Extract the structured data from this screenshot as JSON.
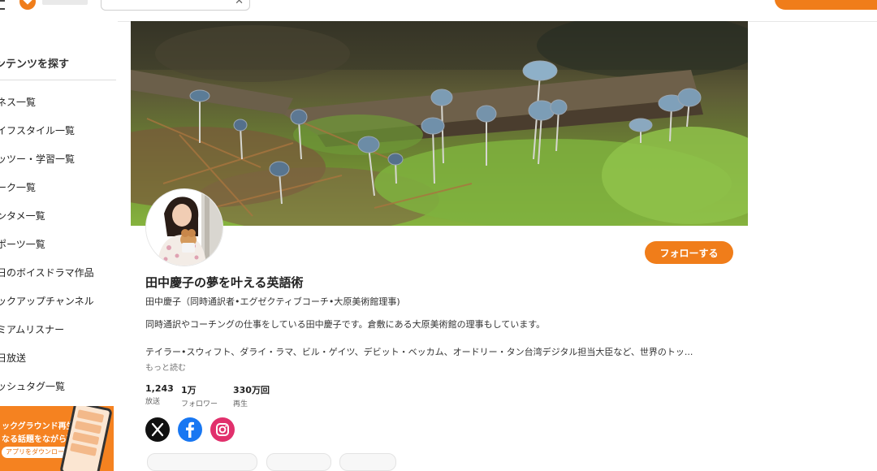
{
  "sidebar": {
    "title": "ンテンツを探す",
    "items": [
      {
        "label": "ネス一覧"
      },
      {
        "label": "イフスタイル一覧"
      },
      {
        "label": "ッツー・学習一覧"
      },
      {
        "label": "ーク一覧"
      },
      {
        "label": "ンタメ一覧"
      },
      {
        "label": "ポーツ一覧"
      },
      {
        "label": "日のボイスドラマ作品"
      },
      {
        "label": "ックアップチャンネル"
      },
      {
        "label": "ミアムリスナー"
      },
      {
        "label": "日放送"
      },
      {
        "label": "ッシュタグ一覧"
      }
    ],
    "banner": {
      "line1": "ックグラウンド再生で",
      "line2": "なる話題をながら聴き",
      "button": "アプリをダウンロード ›"
    }
  },
  "channel": {
    "title": "田中慶子の夢を叶える英語術",
    "host": "田中慶子（同時通訳者•エグゼクティブコーチ•大原美術館理事)",
    "description_line1": "同時通訳やコーチングの仕事をしている田中慶子です。倉敷にある大原美術館の理事もしています。",
    "description_line2": "テイラー•スウィフト、ダライ・ラマ、ビル・ゲイツ、デビット・ベッカム、オードリー・タン台湾デジタル担当大臣など、世界のトッ...",
    "read_more": "もっと読む",
    "follow_label": "フォローする",
    "stats": [
      {
        "value": "1,243",
        "label": "放送"
      },
      {
        "value": "1万",
        "label": "フォロワー"
      },
      {
        "value": "330万回",
        "label": "再生"
      }
    ]
  },
  "social": {
    "x": "x-icon",
    "facebook": "facebook-icon",
    "instagram": "instagram-icon"
  },
  "colors": {
    "accent": "#f07d1a",
    "facebook": "#1877f2",
    "instagram": "#e1306c"
  }
}
